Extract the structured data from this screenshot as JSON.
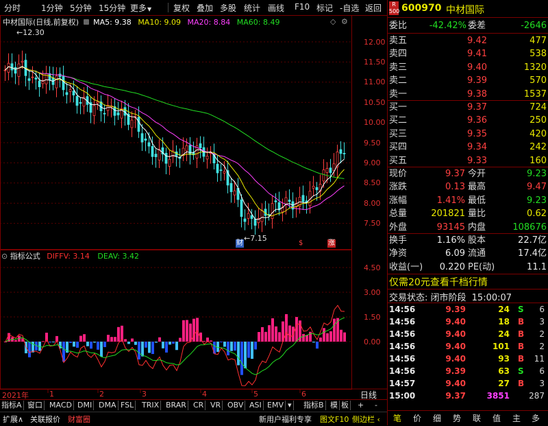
{
  "toolbar": {
    "items": [
      "分时",
      "1分钟",
      "5分钟",
      "15分钟",
      "更多",
      "复权",
      "叠加",
      "多股",
      "统计",
      "画线",
      "F10",
      "标记",
      "-自选",
      "返回"
    ],
    "more_arrow": "▼"
  },
  "chart": {
    "title": "中材国际(日线,前复权)",
    "ma5_label": "MA5: 9.38",
    "ma10_label": "MA10: 9.09",
    "ma20_label": "MA20: 8.84",
    "ma60_label": "MA60: 8.49",
    "high_marker": "12.30",
    "low_marker": "7.15",
    "event_marks": [
      "财",
      "$",
      "涨"
    ],
    "price_ticks": [
      "12.00",
      "11.50",
      "11.00",
      "10.50",
      "10.00",
      "9.50",
      "9.00",
      "8.50",
      "8.00",
      "7.50"
    ],
    "colors": {
      "ma5": "#ffffff",
      "ma10": "#e8e800",
      "ma20": "#ff40ff",
      "ma60": "#22dd22",
      "up": "#ff4040",
      "down": "#40e0e0"
    }
  },
  "indicator": {
    "title": "指标公式",
    "diffv_label": "DIFFV: 3.14",
    "deav_label": "DEAV: 3.42",
    "ticks": [
      "4.50",
      "3.00",
      "1.50",
      "0.00"
    ]
  },
  "date_axis": {
    "labels": [
      "2021年",
      "1",
      "2",
      "3",
      "4",
      "5",
      "6"
    ],
    "right_label": "日线"
  },
  "bottom_tabs": {
    "row1": [
      "指标A",
      "窗口",
      "MACD",
      "DMI",
      "DMA",
      "FSL",
      "TRIX",
      "BRAR",
      "CR",
      "VR",
      "OBV",
      "ASI",
      "EMV",
      "▾",
      "指标B",
      "模",
      "板",
      "+",
      "-"
    ],
    "row2": [
      "扩展∧",
      "关联报价",
      "财富圈"
    ],
    "promo": "新用户福利专享",
    "f10": "图文F10",
    "sidebar": "侧边栏 ‹"
  },
  "quote": {
    "badge_top": "R",
    "badge_bottom": "500",
    "code": "600970",
    "name": "中材国际",
    "weibi_label": "委比",
    "weibi_value": "-42.42%",
    "weicha_label": "委差",
    "weicha_value": "-2646",
    "asks": [
      {
        "label": "卖五",
        "price": "9.42",
        "vol": "477"
      },
      {
        "label": "卖四",
        "price": "9.41",
        "vol": "538"
      },
      {
        "label": "卖三",
        "price": "9.40",
        "vol": "1320"
      },
      {
        "label": "卖二",
        "price": "9.39",
        "vol": "570"
      },
      {
        "label": "卖一",
        "price": "9.38",
        "vol": "1537"
      }
    ],
    "bids": [
      {
        "label": "买一",
        "price": "9.37",
        "vol": "724"
      },
      {
        "label": "买二",
        "price": "9.36",
        "vol": "250"
      },
      {
        "label": "买三",
        "price": "9.35",
        "vol": "420"
      },
      {
        "label": "买四",
        "price": "9.34",
        "vol": "242"
      },
      {
        "label": "买五",
        "price": "9.33",
        "vol": "160"
      }
    ],
    "stats": [
      {
        "l1": "现价",
        "v1": "9.37",
        "l2": "今开",
        "v2": "9.23"
      },
      {
        "l1": "涨跌",
        "v1": "0.13",
        "l2": "最高",
        "v2": "9.47"
      },
      {
        "l1": "涨幅",
        "v1": "1.41%",
        "l2": "最低",
        "v2": "9.23"
      },
      {
        "l1": "总量",
        "v1": "201821",
        "l2": "量比",
        "v2": "0.62"
      },
      {
        "l1": "外盘",
        "v1": "93145",
        "l2": "内盘",
        "v2": "108676"
      }
    ],
    "stats2": [
      {
        "l1": "换手",
        "v1": "1.16%",
        "l2": "股本",
        "v2": "22.7亿"
      },
      {
        "l1": "净资",
        "v1": "6.09",
        "l2": "流通",
        "v2": "17.4亿"
      },
      {
        "l1": "收益(一)",
        "v1": "0.220",
        "l2": "PE(动)",
        "v2": "11.1"
      }
    ],
    "promo": "仅需20元查看千档行情",
    "status_label": "交易状态: 闭市阶段",
    "status_time": "15:00:07",
    "ticks": [
      {
        "t": "14:56",
        "p": "9.39",
        "v": "24",
        "f": "S",
        "n": "6"
      },
      {
        "t": "14:56",
        "p": "9.40",
        "v": "18",
        "f": "B",
        "n": "3"
      },
      {
        "t": "14:56",
        "p": "9.40",
        "v": "24",
        "f": "B",
        "n": "2"
      },
      {
        "t": "14:56",
        "p": "9.40",
        "v": "101",
        "f": "B",
        "n": "2"
      },
      {
        "t": "14:56",
        "p": "9.40",
        "v": "93",
        "f": "B",
        "n": "11"
      },
      {
        "t": "14:56",
        "p": "9.39",
        "v": "63",
        "f": "S",
        "n": "6"
      },
      {
        "t": "14:57",
        "p": "9.40",
        "v": "27",
        "f": "B",
        "n": "3"
      },
      {
        "t": "15:00",
        "p": "9.37",
        "v": "3851",
        "f": "",
        "n": "287"
      }
    ],
    "nav": [
      "笔",
      "价",
      "细",
      "势",
      "联",
      "值",
      "主",
      "多"
    ]
  }
}
